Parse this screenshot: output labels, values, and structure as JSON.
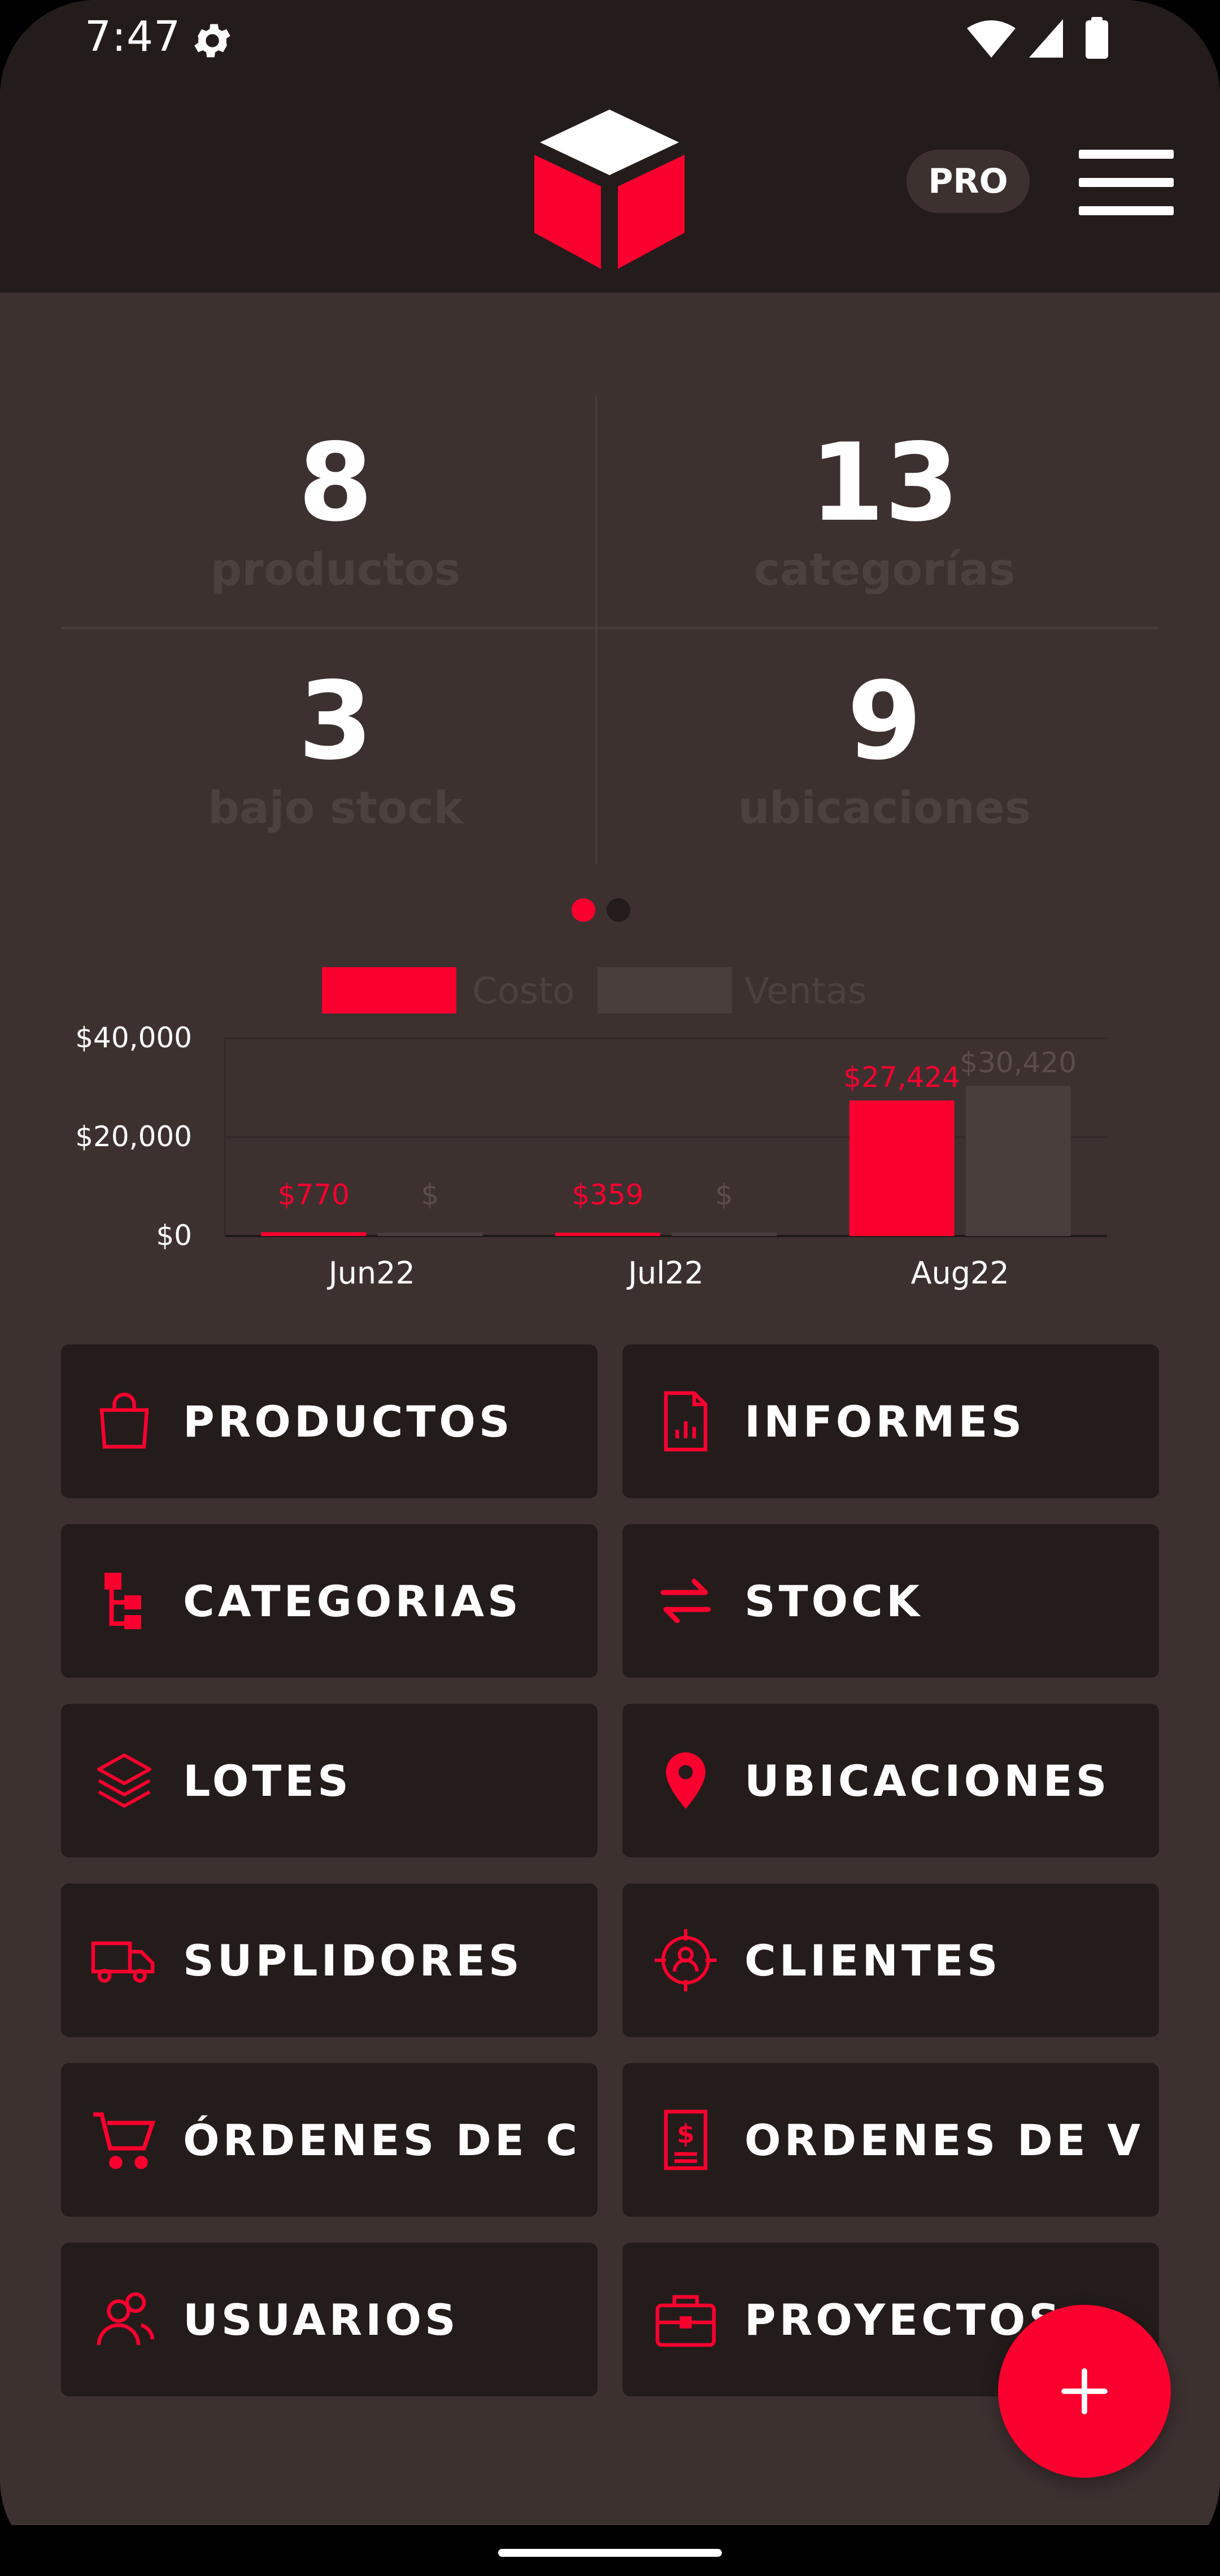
{
  "status": {
    "time": "7:47",
    "icons": [
      "settings-gear-icon",
      "wifi-icon",
      "cellular-signal-icon",
      "battery-icon"
    ]
  },
  "app": {
    "logo": "cube-logo",
    "pro_badge": "PRO",
    "menu_icon": "hamburger-menu-icon"
  },
  "colors": {
    "accent": "#f9002e",
    "background": "#3d3130",
    "surface": "#241c1b",
    "muted": "#4d4140",
    "sales": "#4a3e3c"
  },
  "stats": [
    {
      "value": "8",
      "label": "productos"
    },
    {
      "value": "13",
      "label": "categorías"
    },
    {
      "value": "3",
      "label": "bajo stock"
    },
    {
      "value": "9",
      "label": "ubicaciones"
    }
  ],
  "pager": {
    "pages": 2,
    "active": 1
  },
  "chart_data": {
    "type": "bar",
    "categories": [
      "Jun22",
      "Jul22",
      "Aug22"
    ],
    "series": [
      {
        "name": "Costo",
        "values": [
          770,
          359,
          27424
        ],
        "labels": [
          "$770",
          "$359",
          "$27,424"
        ],
        "color": "#f9002e"
      },
      {
        "name": "Ventas",
        "values": [
          0,
          0,
          30420
        ],
        "labels": [
          "$",
          "$",
          "$30,420"
        ],
        "color": "#4a3e3c"
      }
    ],
    "yticks": [
      "$0",
      "$20,000",
      "$40,000"
    ],
    "ylim": [
      0,
      40000
    ],
    "legend": "top-center",
    "grid": true
  },
  "menu": [
    {
      "label": "PRODUCTOS",
      "icon": "shopping-bag-icon"
    },
    {
      "label": "INFORMES",
      "icon": "report-document-icon"
    },
    {
      "label": "CATEGORIAS",
      "icon": "category-tree-icon"
    },
    {
      "label": "STOCK",
      "icon": "transfer-arrows-icon"
    },
    {
      "label": "LOTES",
      "icon": "layers-icon"
    },
    {
      "label": "UBICACIONES",
      "icon": "location-pin-icon"
    },
    {
      "label": "SUPLIDORES",
      "icon": "delivery-truck-icon"
    },
    {
      "label": "CLIENTES",
      "icon": "client-target-icon"
    },
    {
      "label": "ÓRDENES DE CO",
      "icon": "shopping-cart-icon"
    },
    {
      "label": "ORDENES DE VEI",
      "icon": "invoice-dollar-icon"
    },
    {
      "label": "USUARIOS",
      "icon": "users-icon"
    },
    {
      "label": "PROYECTOS",
      "icon": "briefcase-icon"
    }
  ],
  "fab": {
    "icon": "plus-icon"
  }
}
